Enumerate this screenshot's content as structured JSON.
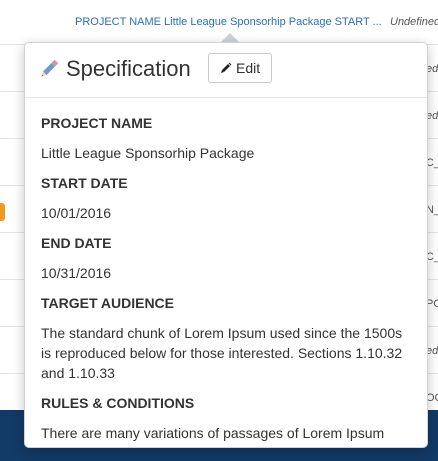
{
  "background": {
    "header": {
      "link_text": "PROJECT NAME Little League Sponsorhip Package START ...",
      "undefined_text": "Undefined"
    },
    "rows": [
      {
        "text": "ed",
        "italic": true
      },
      {
        "text": "ed",
        "italic": true
      },
      {
        "text": "C_",
        "italic": false
      },
      {
        "text": "N_",
        "italic": false
      },
      {
        "text": "C_",
        "italic": false
      },
      {
        "text": "PO",
        "italic": false
      },
      {
        "text": "ed",
        "italic": true
      },
      {
        "text": "OC",
        "italic": false
      }
    ],
    "colors": {
      "footer": "#123a66",
      "accent_orange": "#f29a1f",
      "link": "#2a6ebb"
    }
  },
  "popover": {
    "title": "Specification",
    "icon": "pencil-icon",
    "edit_button": {
      "label": "Edit",
      "icon": "pencil-small-icon"
    },
    "fields": [
      {
        "label": "PROJECT NAME",
        "value": "Little League Sponsorhip Package"
      },
      {
        "label": "START DATE",
        "value": "10/01/2016"
      },
      {
        "label": "END DATE",
        "value": "10/31/2016"
      },
      {
        "label": "TARGET AUDIENCE",
        "value": "The standard chunk of Lorem Ipsum used since the 1500s is reproduced below for those interested. Sections 1.10.32 and 1.10.33"
      },
      {
        "label": "RULES & CONDITIONS",
        "value": "There are many variations of passages of Lorem Ipsum"
      }
    ]
  }
}
